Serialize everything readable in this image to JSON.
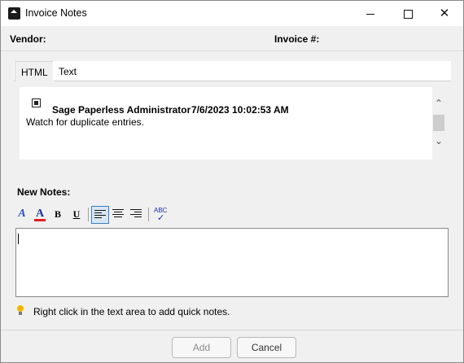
{
  "window": {
    "title": "Invoice Notes",
    "controls": {
      "minimize": "minimize-icon",
      "maximize": "maximize-icon",
      "close": "close-icon"
    }
  },
  "header": {
    "vendor_label": "Vendor:",
    "invoice_label": "Invoice #:"
  },
  "tabs": [
    {
      "label": "HTML",
      "selected": true
    },
    {
      "label": "Text",
      "selected": false
    }
  ],
  "notes": [
    {
      "author": "Sage Paperless Administrator",
      "date": "7/6/2023 10:02:53 AM",
      "body": "Watch for duplicate entries."
    }
  ],
  "new_notes": {
    "label": "New Notes:",
    "value": ""
  },
  "toolbar": {
    "bold": "B",
    "underline": "U",
    "spell": "ABC",
    "font": "A",
    "color": "A",
    "alignment_selected": "left",
    "accent_color": "#3c7fc4"
  },
  "hint": "Right click in the text area to add quick notes.",
  "buttons": {
    "add": "Add",
    "cancel": "Cancel"
  }
}
